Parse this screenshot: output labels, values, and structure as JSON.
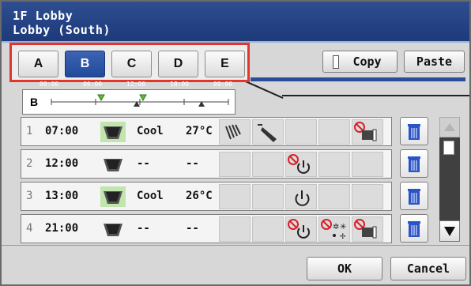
{
  "header": {
    "line1": "1F Lobby",
    "line2": "Lobby (South)"
  },
  "tabs": [
    "A",
    "B",
    "C",
    "D",
    "E"
  ],
  "active_tab": "B",
  "buttons": {
    "copy": "Copy",
    "paste": "Paste",
    "ok": "OK",
    "cancel": "Cancel"
  },
  "timeline": {
    "letter": "B",
    "labels": [
      "00:00",
      "06:00",
      "12:00",
      "18:00",
      "00:00"
    ]
  },
  "rows": [
    {
      "num": "1",
      "time": "07:00",
      "unit": "on",
      "mode": "Cool",
      "temp": "27°C"
    },
    {
      "num": "2",
      "time": "12:00",
      "unit": "off",
      "mode": "--",
      "temp": "--"
    },
    {
      "num": "3",
      "time": "13:00",
      "unit": "on",
      "mode": "Cool",
      "temp": "26°C"
    },
    {
      "num": "4",
      "time": "21:00",
      "unit": "off",
      "mode": "--",
      "temp": "--"
    }
  ],
  "colors": {
    "header": "#1d3a7a",
    "active_tab": "#214b9a",
    "highlight": "#e0362b",
    "unit_on": "#6cc04a",
    "prohibit": "#d8202a"
  }
}
